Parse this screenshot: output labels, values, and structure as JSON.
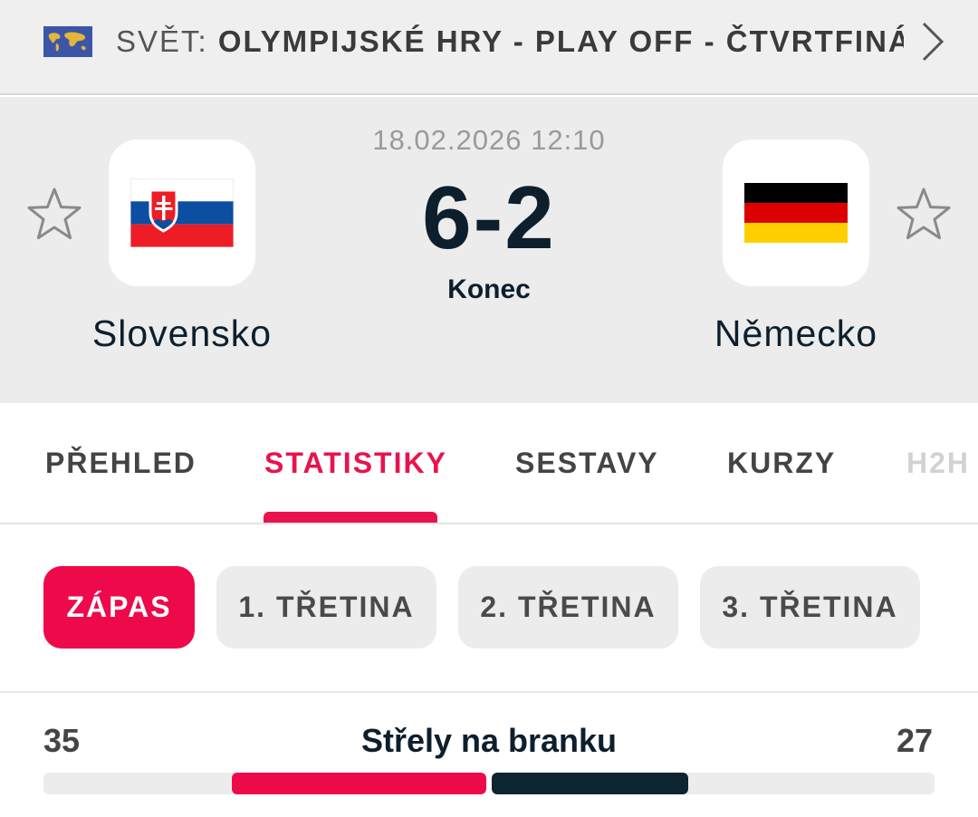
{
  "breadcrumb": {
    "country": "SVĚT:",
    "competition": "OLYMPIJSKÉ HRY - PLAY OFF - ČTVRTFINÁ..."
  },
  "match": {
    "datetime": "18.02.2026 12:10",
    "score": "6-2",
    "status": "Konec",
    "home": {
      "name": "Slovensko",
      "flag": "slovakia-flag"
    },
    "away": {
      "name": "Německo",
      "flag": "germany-flag"
    }
  },
  "tabs": [
    {
      "label": "PŘEHLED",
      "active": false
    },
    {
      "label": "STATISTIKY",
      "active": true
    },
    {
      "label": "SESTAVY",
      "active": false
    },
    {
      "label": "KURZY",
      "active": false
    },
    {
      "label": "H2H",
      "active": false
    }
  ],
  "periods": [
    {
      "label": "ZÁPAS",
      "active": true
    },
    {
      "label": "1. TŘETINA",
      "active": false
    },
    {
      "label": "2. TŘETINA",
      "active": false
    },
    {
      "label": "3. TŘETINA",
      "active": false
    }
  ],
  "stats": [
    {
      "label": "Střely na branku",
      "home": "35",
      "away": "27"
    }
  ],
  "colors": {
    "accent": "#e8134d",
    "home_bar": "#ee0a4a",
    "away_bar": "#0d2530",
    "dark_text": "#0d1f2d"
  }
}
